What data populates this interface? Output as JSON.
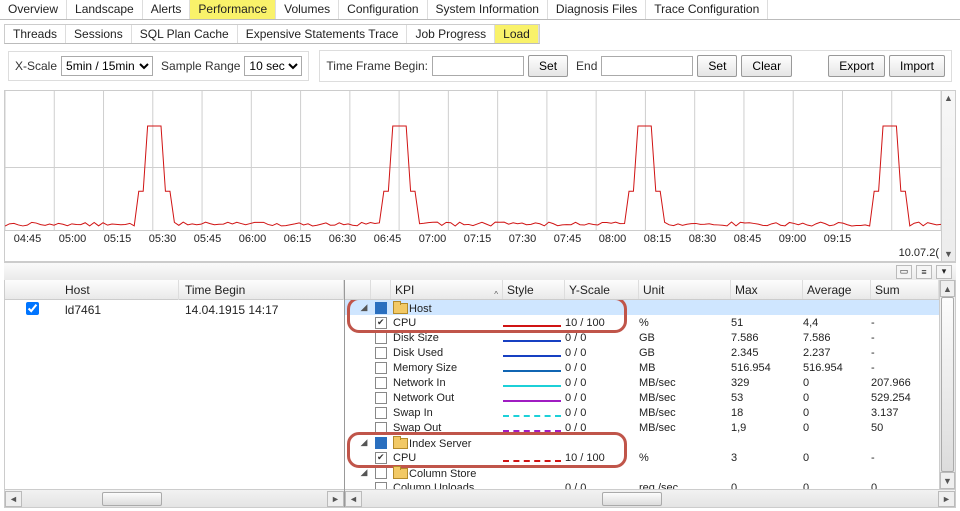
{
  "top_tabs": [
    "Overview",
    "Landscape",
    "Alerts",
    "Performance",
    "Volumes",
    "Configuration",
    "System Information",
    "Diagnosis Files",
    "Trace Configuration"
  ],
  "top_tab_active": 3,
  "sub_tabs": [
    "Threads",
    "Sessions",
    "SQL Plan Cache",
    "Expensive Statements Trace",
    "Job Progress",
    "Load"
  ],
  "sub_tab_active": 5,
  "toolbar": {
    "xscale_label": "X-Scale",
    "xscale_value": "5min / 15min",
    "sample_label": "Sample Range",
    "sample_value": "10 sec",
    "tf_begin_label": "Time Frame Begin:",
    "tf_begin_value": "",
    "set_label": "Set",
    "end_label": "End",
    "end_value": "",
    "clear_label": "Clear",
    "export_label": "Export",
    "import_label": "Import"
  },
  "chart_date": "10.07.2(",
  "chart_data": {
    "type": "line",
    "title": "",
    "xlabel": "",
    "ylabel": "",
    "ylim": [
      0,
      100
    ],
    "x_ticks": [
      "04:45",
      "05:00",
      "05:15",
      "05:30",
      "05:45",
      "06:00",
      "06:15",
      "06:30",
      "06:45",
      "07:00",
      "07:15",
      "07:30",
      "07:45",
      "08:00",
      "08:15",
      "08:30",
      "08:45",
      "09:00",
      "09:15"
    ],
    "series": [
      {
        "name": "CPU %",
        "color": "#d01414",
        "x": [
          0,
          1,
          2,
          3,
          4,
          5,
          6,
          7,
          8,
          9,
          10,
          11,
          12,
          13,
          14,
          15,
          16,
          17,
          18,
          19
        ],
        "values": [
          3,
          3,
          4,
          70,
          3,
          4,
          3,
          4,
          65,
          3,
          3,
          4,
          3,
          68,
          4,
          3,
          3,
          4,
          72,
          3
        ]
      }
    ],
    "spike_positions": [
      3,
      8,
      13,
      18
    ]
  },
  "left_grid": {
    "headers": [
      "",
      "Host",
      "Time Begin"
    ],
    "rows": [
      {
        "checked": true,
        "host": "ld7461",
        "time_begin": "14.04.1915 14:17"
      }
    ]
  },
  "right_grid": {
    "headers": [
      "",
      "",
      "KPI",
      "Style",
      "Y-Scale",
      "Unit",
      "Max",
      "Average",
      "Sum"
    ],
    "sort_col": "KPI",
    "rows": [
      {
        "type": "group",
        "depth": 0,
        "label": "Host",
        "cb": "solid",
        "selected": true
      },
      {
        "type": "kpi",
        "depth": 1,
        "cb": "checked",
        "kpi": "CPU",
        "style_color": "#d01414",
        "style_dash": "solid",
        "yscale": "10 / 100",
        "unit": "%",
        "max": "51",
        "avg": "4,4",
        "sum": "-"
      },
      {
        "type": "kpi",
        "depth": 1,
        "cb": "",
        "kpi": "Disk Size",
        "style_color": "#1740c2",
        "style_dash": "solid",
        "yscale": "0 / 0",
        "unit": "GB",
        "max": "7.586",
        "avg": "7.586",
        "sum": "-"
      },
      {
        "type": "kpi",
        "depth": 1,
        "cb": "",
        "kpi": "Disk Used",
        "style_color": "#1740c2",
        "style_dash": "solid",
        "yscale": "0 / 0",
        "unit": "GB",
        "max": "2.345",
        "avg": "2.237",
        "sum": "-"
      },
      {
        "type": "kpi",
        "depth": 1,
        "cb": "",
        "kpi": "Memory Size",
        "style_color": "#1065b3",
        "style_dash": "solid",
        "yscale": "0 / 0",
        "unit": "MB",
        "max": "516.954",
        "avg": "516.954",
        "sum": "-"
      },
      {
        "type": "kpi",
        "depth": 1,
        "cb": "",
        "kpi": "Network In",
        "style_color": "#1cd0d8",
        "style_dash": "solid",
        "yscale": "0 / 0",
        "unit": "MB/sec",
        "max": "329",
        "avg": "0",
        "sum": "207.966"
      },
      {
        "type": "kpi",
        "depth": 1,
        "cb": "",
        "kpi": "Network Out",
        "style_color": "#a01cc2",
        "style_dash": "solid",
        "yscale": "0 / 0",
        "unit": "MB/sec",
        "max": "53",
        "avg": "0",
        "sum": "529.254"
      },
      {
        "type": "kpi",
        "depth": 1,
        "cb": "",
        "kpi": "Swap In",
        "style_color": "#1cd0d8",
        "style_dash": "dashed",
        "yscale": "0 / 0",
        "unit": "MB/sec",
        "max": "18",
        "avg": "0",
        "sum": "3.137"
      },
      {
        "type": "kpi",
        "depth": 1,
        "cb": "",
        "kpi": "Swap Out",
        "style_color": "#a01cc2",
        "style_dash": "dashed",
        "yscale": "0 / 0",
        "unit": "MB/sec",
        "max": "1,9",
        "avg": "0",
        "sum": "50"
      },
      {
        "type": "group",
        "depth": 0,
        "label": "Index Server",
        "cb": "solid"
      },
      {
        "type": "kpi",
        "depth": 1,
        "cb": "checked",
        "kpi": "CPU",
        "style_color": "#d01414",
        "style_dash": "dashed",
        "yscale": "10 / 100",
        "unit": "%",
        "max": "3",
        "avg": "0",
        "sum": "-"
      },
      {
        "type": "group",
        "depth": 1,
        "label": "Column Store",
        "cb": ""
      },
      {
        "type": "kpi",
        "depth": 2,
        "cb": "",
        "kpi": "Column Unloads",
        "style_color": "",
        "style_dash": "",
        "yscale": "0 / 0",
        "unit": "req./sec",
        "max": "0",
        "avg": "0",
        "sum": "0"
      }
    ]
  }
}
